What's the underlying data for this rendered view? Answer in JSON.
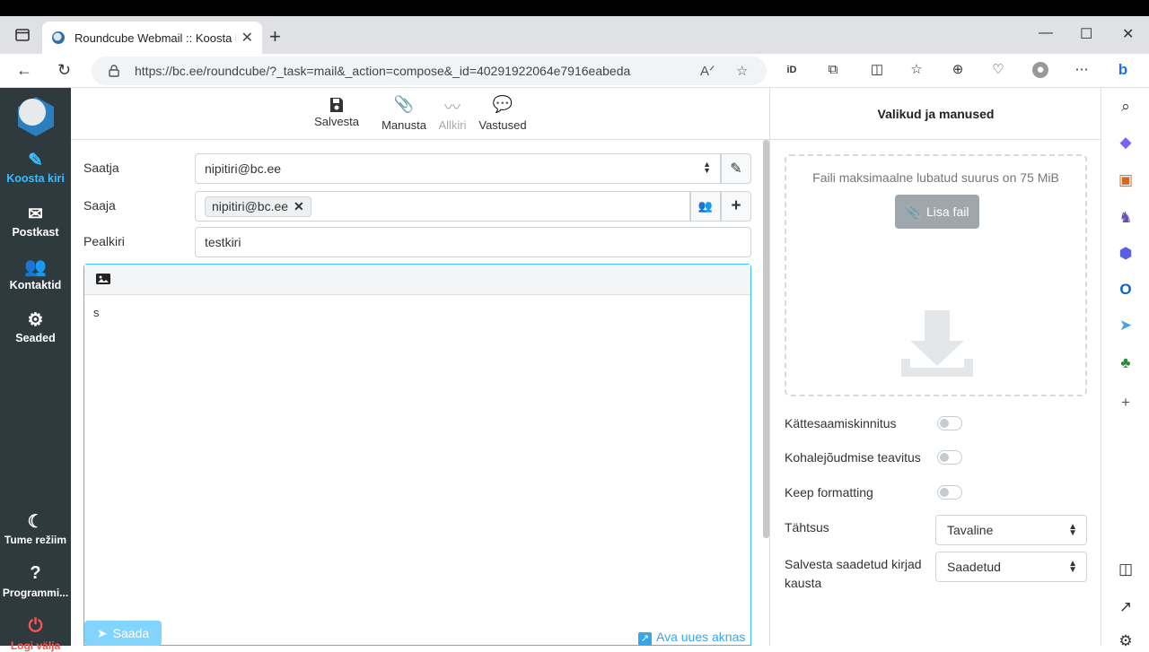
{
  "browser": {
    "tab_title": "Roundcube Webmail :: Koosta kir",
    "url": "https://bc.ee/roundcube/?_task=mail&_action=compose&_id=40291922064e7916eabeda"
  },
  "nav": {
    "compose": "Koosta kiri",
    "mailbox": "Postkast",
    "contacts": "Kontaktid",
    "settings": "Seaded",
    "dark_mode": "Tume režiim",
    "about": "Programmi...",
    "logout": "Logi välja"
  },
  "toolbar": {
    "save": "Salvesta",
    "attach": "Manusta",
    "signature": "Allkiri",
    "responses": "Vastused"
  },
  "form": {
    "from_label": "Saatja",
    "from_value": "nipitiri@bc.ee",
    "to_label": "Saaja",
    "to_recipient": "nipitiri@bc.ee",
    "subject_label": "Pealkiri",
    "subject_value": "testkiri",
    "body_text": "s"
  },
  "footer": {
    "send": "Saada",
    "open_new_window": "Ava uues aknas"
  },
  "sidebar": {
    "title": "Valikud ja manused",
    "max_size_hint": "Faili maksimaalne lubatud suurus on 75 MiB",
    "add_file": "Lisa fail",
    "read_receipt": "Kättesaamiskinnitus",
    "delivery_notice": "Kohalejõudmise teavitus",
    "keep_formatting": "Keep formatting",
    "priority_label": "Tähtsus",
    "priority_value": "Tavaline",
    "save_sent_label": "Salvesta saadetud kirjad kausta",
    "save_sent_value": "Saadetud"
  },
  "colors": {
    "accent": "#37beff",
    "nav_bg": "#2f3a3f"
  }
}
